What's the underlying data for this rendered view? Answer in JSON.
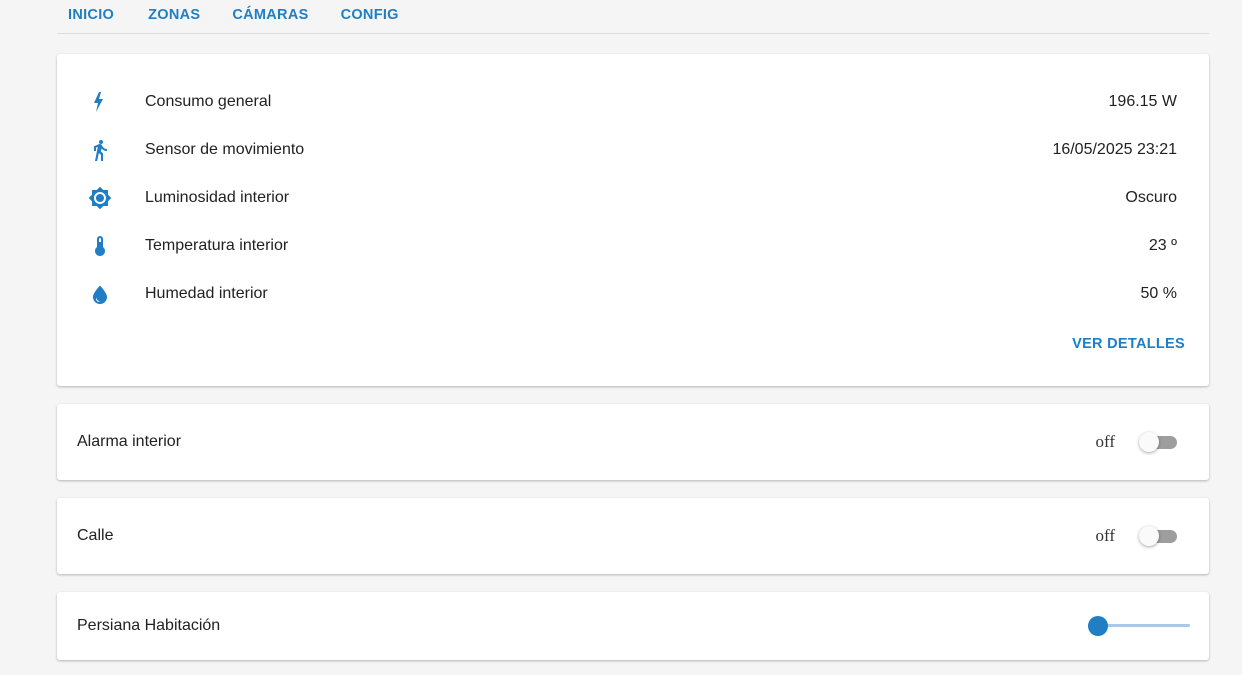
{
  "tabs": [
    {
      "label": "INICIO"
    },
    {
      "label": "ZONAS"
    },
    {
      "label": "CÁMARAS"
    },
    {
      "label": "CONFIG"
    }
  ],
  "sensors_card": {
    "rows": [
      {
        "icon": "flash-icon",
        "label": "Consumo general",
        "value": "196.15 W"
      },
      {
        "icon": "walk-icon",
        "label": "Sensor de movimiento",
        "value": "16/05/2025 23:21"
      },
      {
        "icon": "brightness-icon",
        "label": "Luminosidad interior",
        "value": "Oscuro"
      },
      {
        "icon": "thermometer-icon",
        "label": "Temperatura interior",
        "value": "23 º"
      },
      {
        "icon": "water-drop-icon",
        "label": "Humedad interior",
        "value": "50 %"
      }
    ],
    "details_label": "VER DETALLES"
  },
  "alarm_card": {
    "label": "Alarma interior",
    "state": "off"
  },
  "calle_card": {
    "label": "Calle",
    "state": "off"
  },
  "persiana_card": {
    "label": "Persiana Habitación",
    "position": 0
  },
  "colors": {
    "accent": "#1f7ec4",
    "slider_track": "#a9c9ec",
    "toggle_off_track": "#9e9e9e"
  }
}
